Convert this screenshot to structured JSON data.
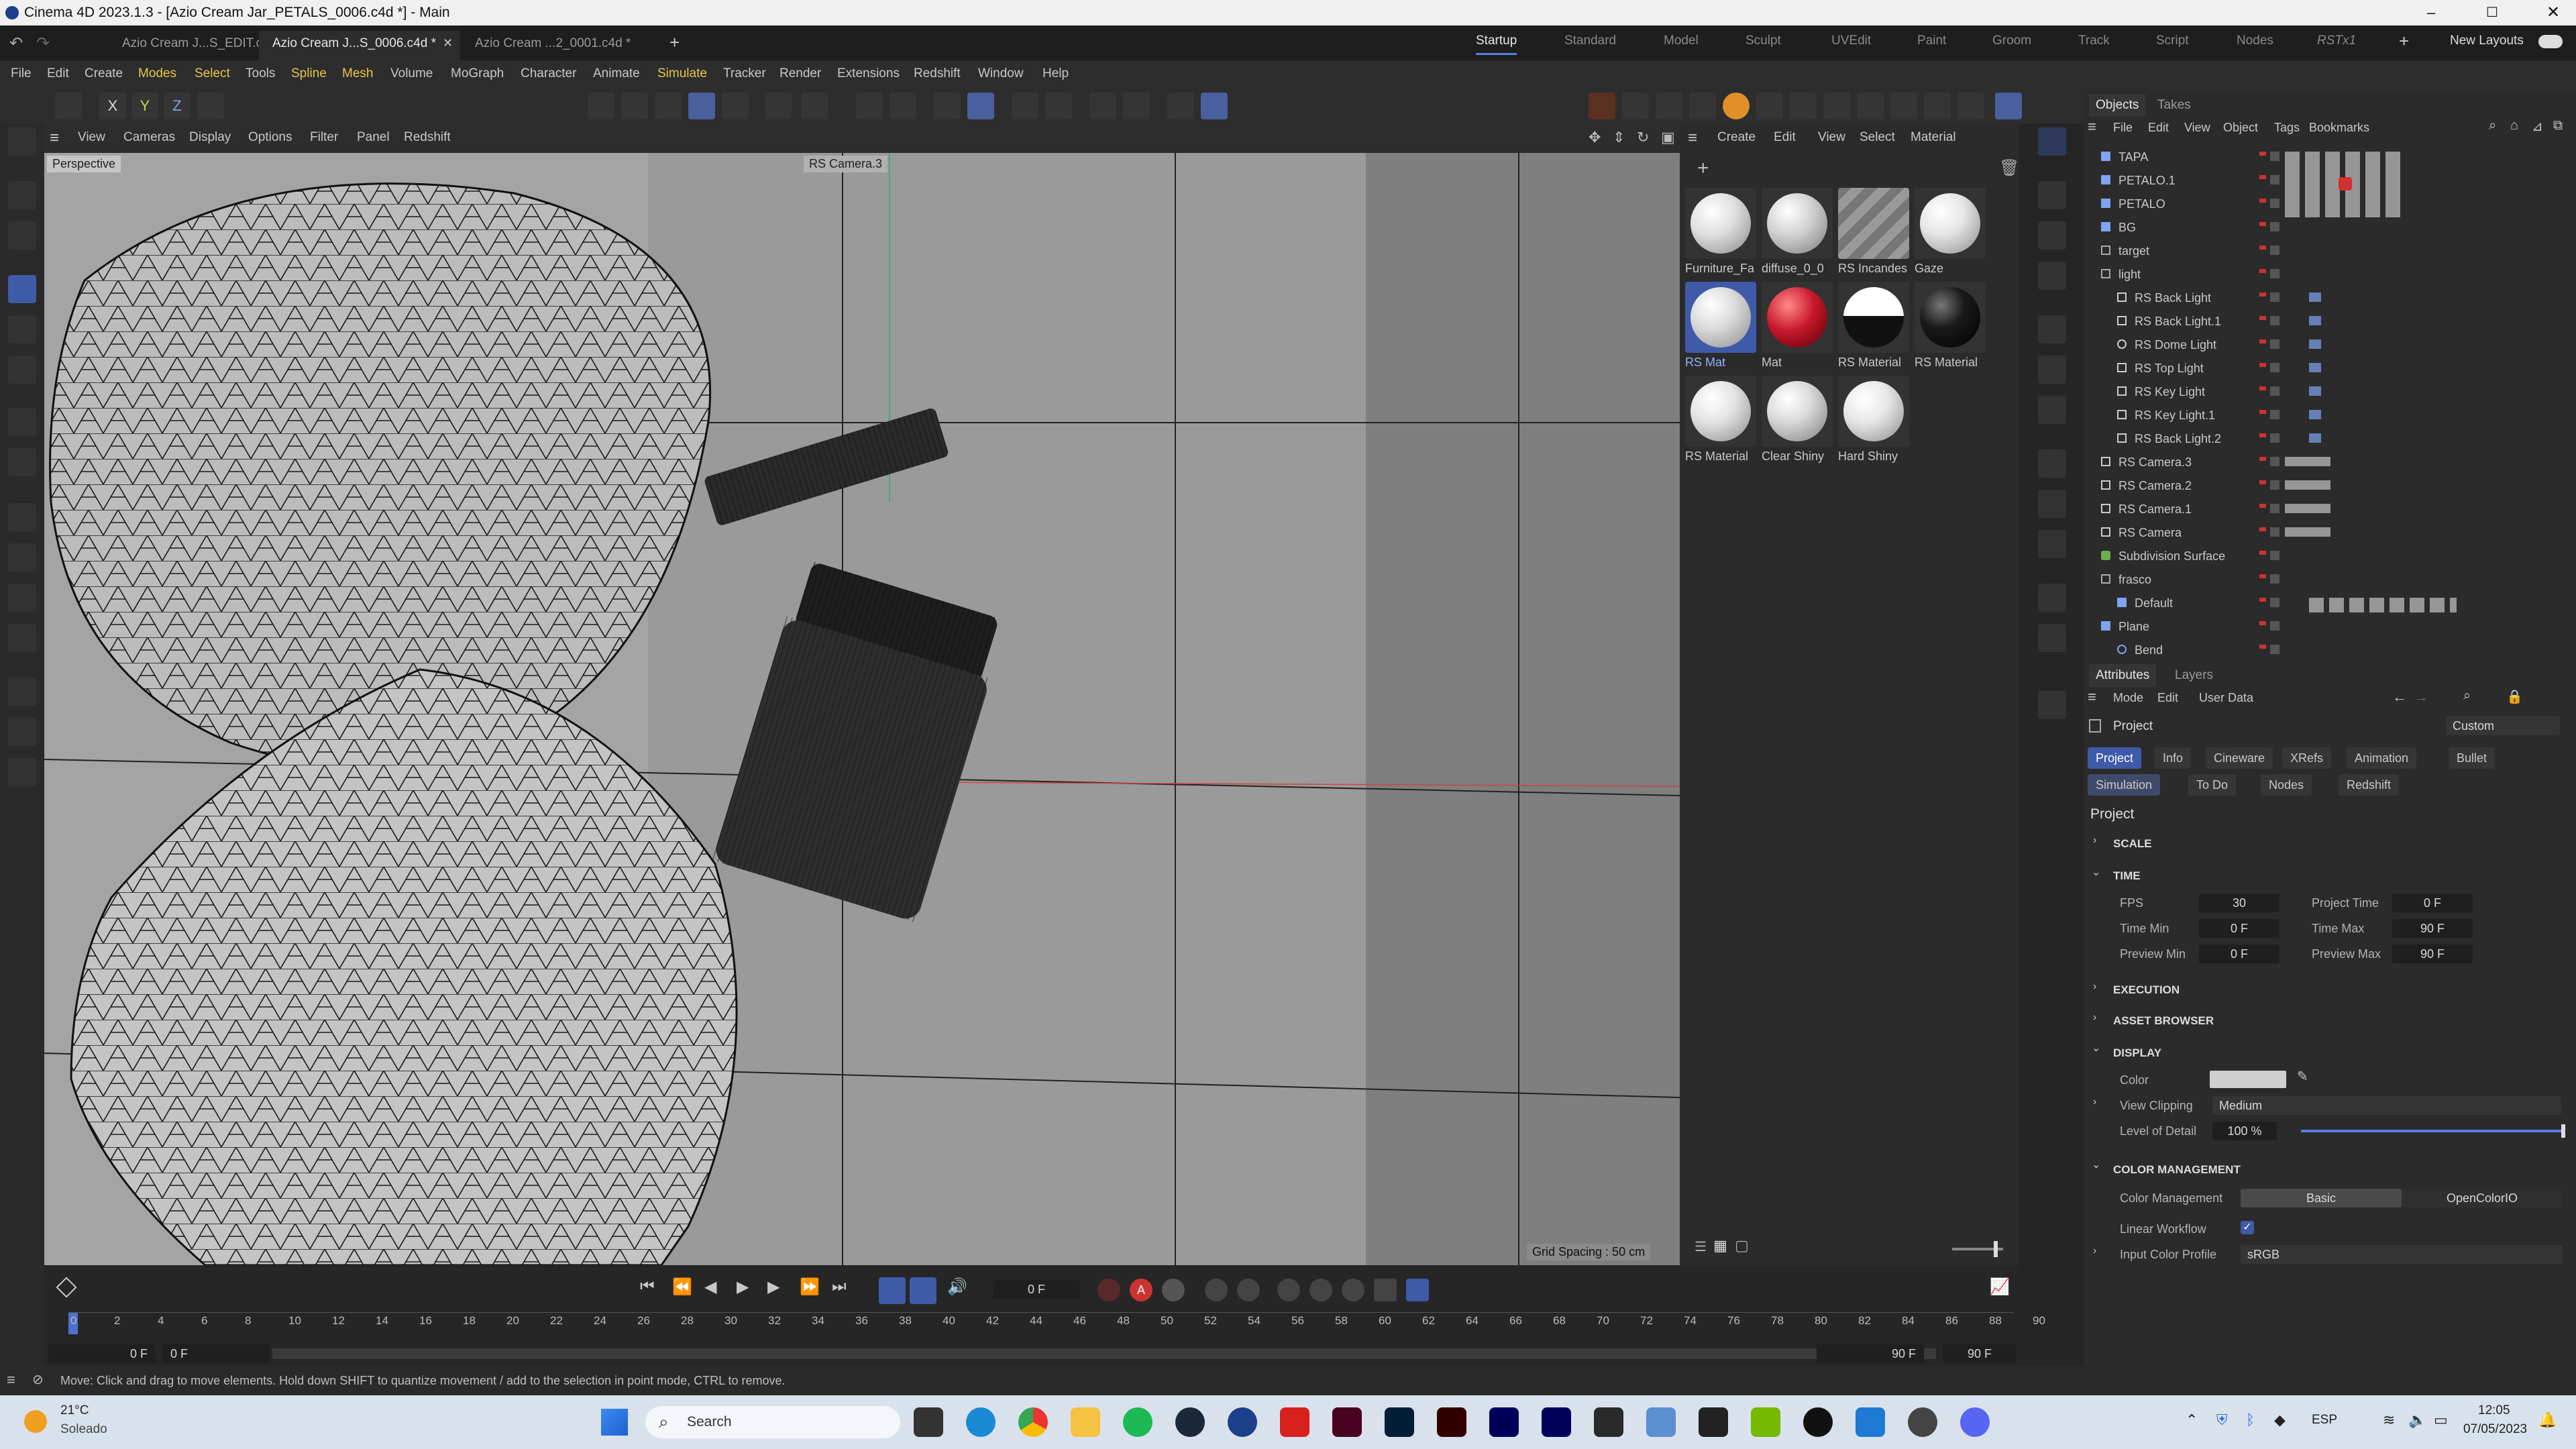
{
  "window": {
    "title": "Cinema 4D 2023.1.3 - [Azio Cream Jar_PETALS_0006.c4d *] - Main"
  },
  "doc_tabs": [
    "Azio Cream J...S_EDIT.c4d *",
    "Azio Cream J...S_0006.c4d *",
    "Azio Cream ...2_0001.c4d *"
  ],
  "layouts": [
    "Startup",
    "Standard",
    "Model",
    "Sculpt",
    "UVEdit",
    "Paint",
    "Groom",
    "Track",
    "Script",
    "Nodes",
    "RSTx1"
  ],
  "new_layouts": "New Layouts",
  "menu": [
    "File",
    "Edit",
    "Create",
    "Modes",
    "Select",
    "Tools",
    "Spline",
    "Mesh",
    "Volume",
    "MoGraph",
    "Character",
    "Animate",
    "Simulate",
    "Tracker",
    "Render",
    "Extensions",
    "Redshift",
    "Window",
    "Help"
  ],
  "axis_lock": [
    "X",
    "Y",
    "Z"
  ],
  "viewport": {
    "menu": [
      "View",
      "Cameras",
      "Display",
      "Options",
      "Filter",
      "Panel",
      "Redshift"
    ],
    "label": "Perspective",
    "camera": "RS Camera.3",
    "grid_spacing": "Grid Spacing : 50 cm"
  },
  "materials": {
    "menu": [
      "Create",
      "Edit",
      "View",
      "Select",
      "Material"
    ],
    "items": [
      {
        "name": "Furniture_Fa",
        "color": "#e0e0e0"
      },
      {
        "name": "diffuse_0_0",
        "color": "#d4d4d4"
      },
      {
        "name": "RS Incandes",
        "color": "#8a8a8a"
      },
      {
        "name": "Gaze",
        "color": "#e6e6e6"
      },
      {
        "name": "RS Mat",
        "color": "#dcdcdc"
      },
      {
        "name": "Mat",
        "color": "#c8182c"
      },
      {
        "name": "RS Material",
        "color": "#111111"
      },
      {
        "name": "RS Material",
        "color": "#1a1a1a"
      },
      {
        "name": "RS Material",
        "color": "#e4e4e4"
      },
      {
        "name": "Clear Shiny",
        "color": "#dadada"
      },
      {
        "name": "Hard Shiny",
        "color": "#e8e8e8"
      }
    ]
  },
  "objects": {
    "tabs": [
      "Objects",
      "Takes"
    ],
    "menu": [
      "File",
      "Edit",
      "View",
      "Object",
      "Tags",
      "Bookmarks"
    ],
    "rows": [
      "TAPA",
      "PETALO.1",
      "PETALO",
      "BG",
      "target",
      "light",
      "RS Back Light",
      "RS Back Light.1",
      "RS Dome Light",
      "RS Top Light",
      "RS Key Light",
      "RS Key Light.1",
      "RS Back Light.2",
      "RS Camera.3",
      "RS Camera.2",
      "RS Camera.1",
      "RS Camera",
      "Subdivision Surface",
      "frasco",
      "Default",
      "Plane",
      "Bend"
    ]
  },
  "attributes": {
    "tabs": [
      "Attributes",
      "Layers"
    ],
    "menu": [
      "Mode",
      "Edit",
      "User Data"
    ],
    "object": "Project",
    "preset": "Custom",
    "project_tabs": [
      "Project",
      "Info",
      "Cineware",
      "XRefs",
      "Animation",
      "Bullet",
      "Simulation",
      "To Do",
      "Nodes",
      "Redshift"
    ],
    "heading": "Project",
    "sections": {
      "scale": "SCALE",
      "time": "TIME",
      "execution": "EXECUTION",
      "asset_browser": "ASSET BROWSER",
      "display": "DISPLAY",
      "color_management": "COLOR MANAGEMENT"
    },
    "time": {
      "fps_label": "FPS",
      "fps": "30",
      "project_time_label": "Project Time",
      "project_time": "0 F",
      "time_min_label": "Time Min",
      "time_min": "0 F",
      "time_max_label": "Time Max",
      "time_max": "90 F",
      "preview_min_label": "Preview Min",
      "preview_min": "0 F",
      "preview_max_label": "Preview Max",
      "preview_max": "90 F"
    },
    "display": {
      "color_label": "Color",
      "view_clipping_label": "View Clipping",
      "view_clipping": "Medium",
      "lod_label": "Level of Detail",
      "lod": "100 %"
    },
    "color_mgmt": {
      "label": "Color Management",
      "options": [
        "Basic",
        "OpenColorIO"
      ],
      "linear_label": "Linear Workflow",
      "input_profile_label": "Input Color Profile",
      "input_profile": "sRGB"
    }
  },
  "timeline": {
    "current_frame": "0 F",
    "ticks": [
      "0",
      "2",
      "4",
      "6",
      "8",
      "10",
      "12",
      "14",
      "16",
      "18",
      "20",
      "22",
      "24",
      "26",
      "28",
      "30",
      "32",
      "34",
      "36",
      "38",
      "40",
      "42",
      "44",
      "46",
      "48",
      "50",
      "52",
      "54",
      "56",
      "58",
      "60",
      "62",
      "64",
      "66",
      "68",
      "70",
      "72",
      "74",
      "76",
      "78",
      "80",
      "82",
      "84",
      "86",
      "88",
      "90"
    ],
    "range_start": "0 F",
    "range_start2": "0 F",
    "range_end": "90 F",
    "range_end2": "90 F"
  },
  "status": "Move: Click and drag to move elements. Hold down SHIFT to quantize movement / add to the selection in point mode, CTRL to remove.",
  "taskbar": {
    "temp": "21°C",
    "weather": "Soleado",
    "search": "Search",
    "lang": "ESP",
    "time": "12:05",
    "date": "07/05/2023"
  }
}
